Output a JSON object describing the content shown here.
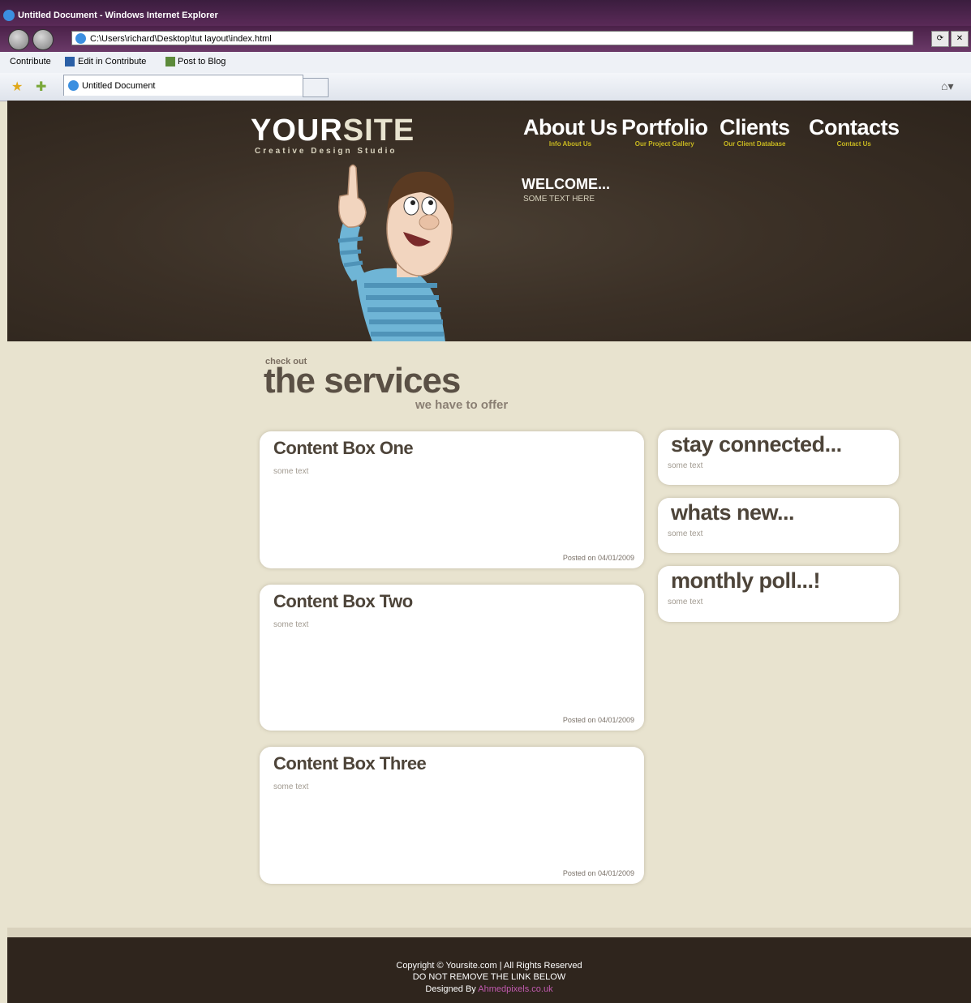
{
  "browser": {
    "window_title": "Untitled Document - Windows Internet Explorer",
    "address": "C:\\Users\\richard\\Desktop\\tut layout\\index.html",
    "commands": [
      "Contribute",
      "Edit in Contribute",
      "Post to Blog"
    ],
    "tab_title": "Untitled Document"
  },
  "header": {
    "logo_main": "YOUR",
    "logo_accent": "SITE",
    "tagline": "Creative Design Studio",
    "nav": [
      {
        "label": "About Us",
        "sub": "Info About Us"
      },
      {
        "label": "Portfolio",
        "sub": "Our Project Gallery"
      },
      {
        "label": "Clients",
        "sub": "Our Client Database"
      },
      {
        "label": "Contacts",
        "sub": "Contact Us"
      }
    ],
    "welcome": "WELCOME...",
    "welcome_sub": "SOME TEXT HERE"
  },
  "services": {
    "small": "check out",
    "big": "the services",
    "sub": "we have to offer"
  },
  "content_boxes": [
    {
      "title": "Content Box One",
      "text": "some text",
      "posted": "Posted on 04/01/2009"
    },
    {
      "title": "Content Box Two",
      "text": "some text",
      "posted": "Posted on 04/01/2009"
    },
    {
      "title": "Content Box Three",
      "text": "some text",
      "posted": "Posted on 04/01/2009"
    }
  ],
  "side_boxes": [
    {
      "title": "stay connected...",
      "text": "some text"
    },
    {
      "title": "whats new...",
      "text": "some text"
    },
    {
      "title": "monthly poll...!",
      "text": "some text"
    }
  ],
  "footer": {
    "copyright": "Copyright © Yoursite.com | All Rights Reserved",
    "notice": "DO NOT REMOVE THE LINK BELOW",
    "designed_by": "Designed By",
    "designer_link": "Ahmedpixels.co.uk"
  },
  "colors": {
    "header_bg": "#3b3026",
    "page_bg": "#e8e3cf",
    "nav_sub": "#c8b820",
    "footer_link": "#c25ab0"
  }
}
